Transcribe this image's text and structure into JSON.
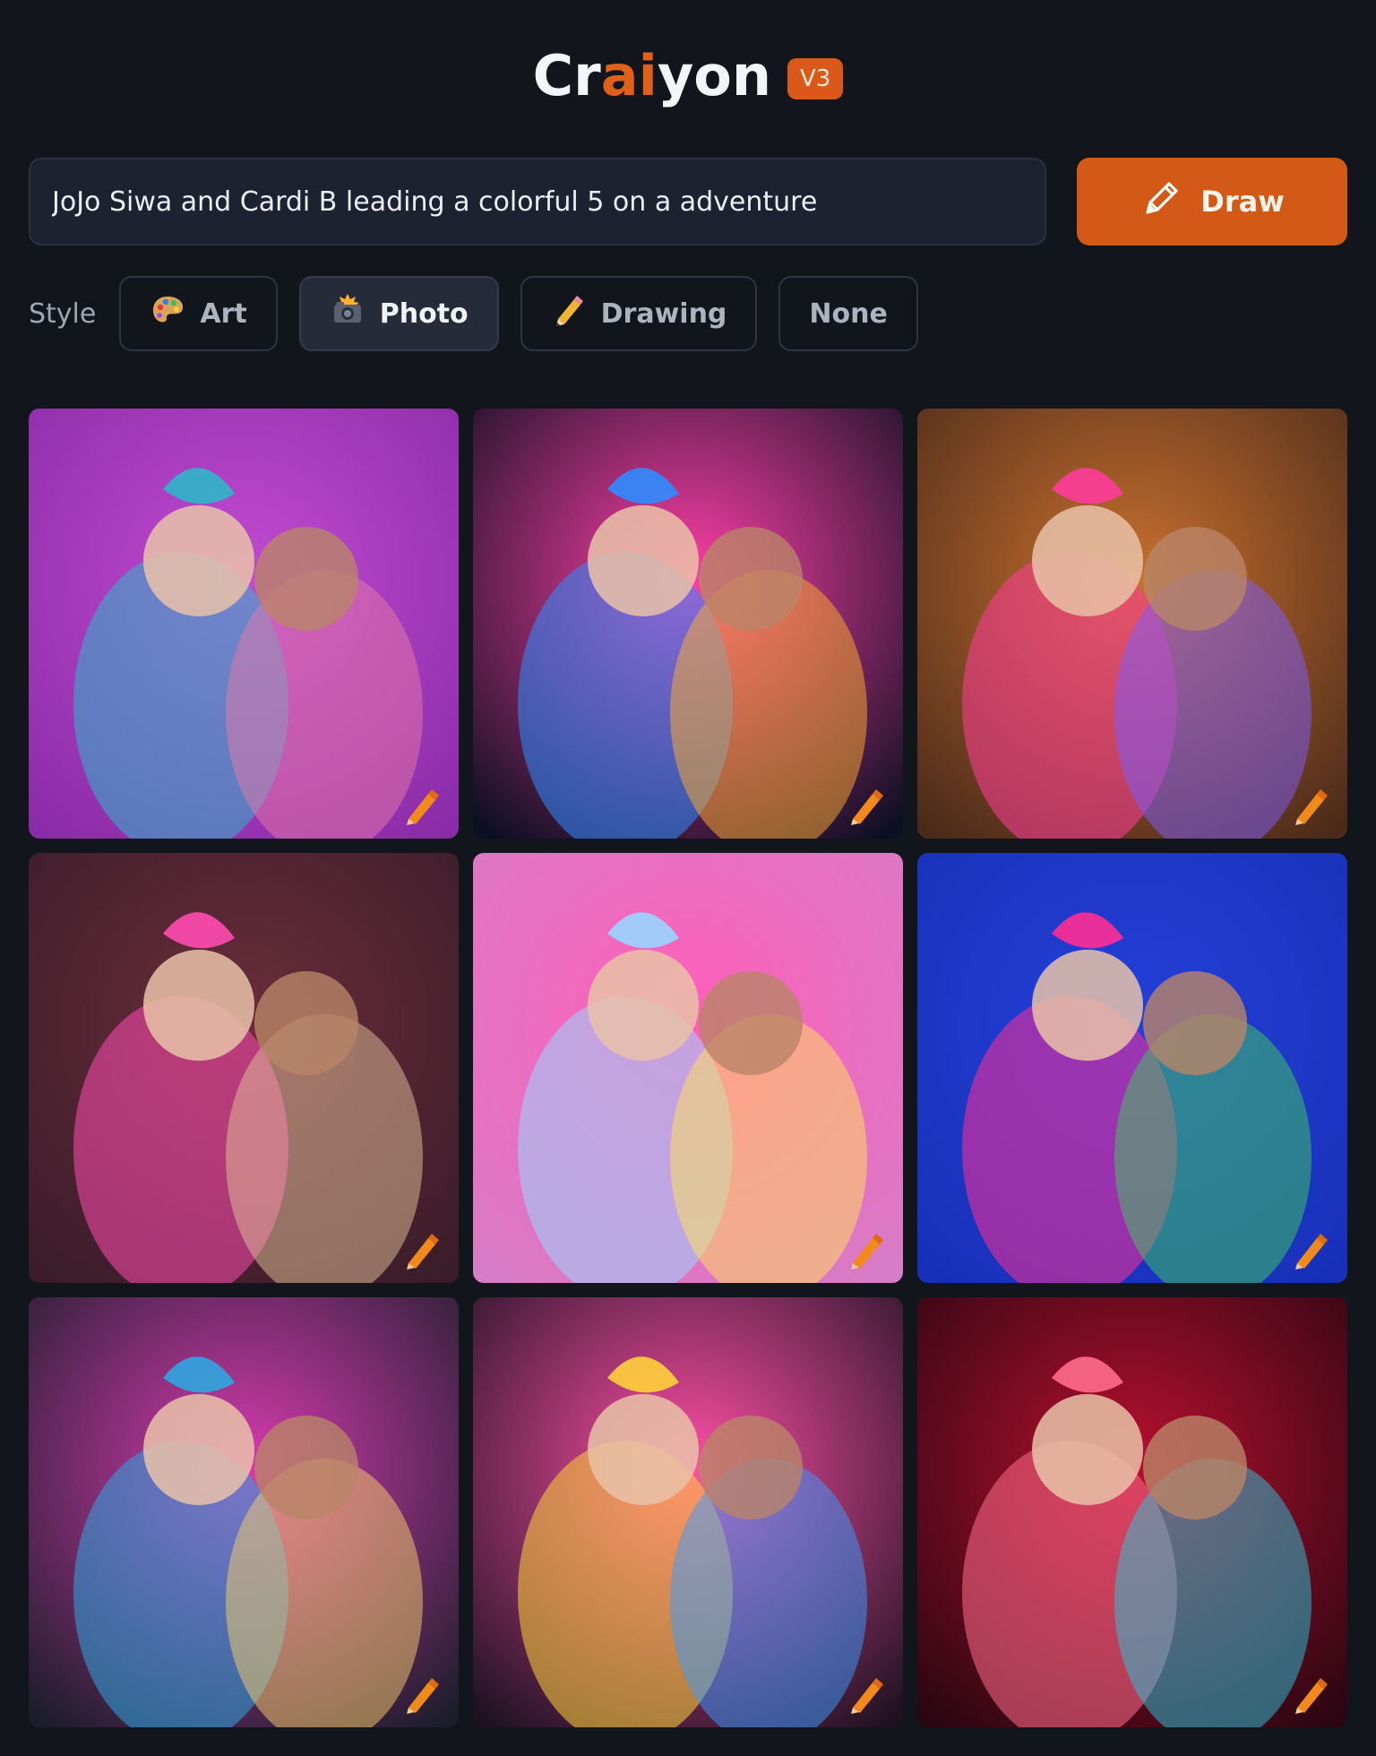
{
  "header": {
    "logo_part1": "Cr",
    "logo_accent": "ai",
    "logo_part2": "yon",
    "version": "V3"
  },
  "prompt": {
    "value": "JoJo Siwa and Cardi B leading a colorful 5 on a adventure"
  },
  "draw_button": {
    "label": "Draw",
    "icon": "pencil-icon"
  },
  "style": {
    "label": "Style",
    "options": [
      {
        "label": "Art",
        "icon": "palette-icon",
        "selected": false
      },
      {
        "label": "Photo",
        "icon": "camera-flash-icon",
        "selected": true
      },
      {
        "label": "Drawing",
        "icon": "pencil-icon",
        "selected": false
      },
      {
        "label": "None",
        "icon": "",
        "selected": false
      }
    ]
  },
  "colors": {
    "background": "#13151d",
    "accent": "#d35a16",
    "input_bg": "#1e2230"
  },
  "results": {
    "count": 9,
    "items": [
      {
        "description": "generated-image",
        "palette": [
          "#8a2ba8",
          "#c24bd1",
          "#2fb6c9",
          "#e67aa8"
        ]
      },
      {
        "description": "generated-image",
        "palette": [
          "#0c0f22",
          "#ff3fa6",
          "#2f8cff",
          "#ffb02e"
        ]
      },
      {
        "description": "generated-image",
        "palette": [
          "#4a2a1a",
          "#c9702e",
          "#ff3d9a",
          "#7c5cff"
        ]
      },
      {
        "description": "generated-image",
        "palette": [
          "#3a1c2a",
          "#6b2d3a",
          "#ff4bb0",
          "#e2c39a"
        ]
      },
      {
        "description": "generated-image",
        "palette": [
          "#d77cc6",
          "#ff5fb9",
          "#9ad6ff",
          "#ffe35a"
        ]
      },
      {
        "description": "generated-image",
        "palette": [
          "#1830b8",
          "#2440d8",
          "#ff2d95",
          "#3ecb5c"
        ]
      },
      {
        "description": "generated-image",
        "palette": [
          "#1c1d2b",
          "#d83bb0",
          "#2fa6e0",
          "#f7d06b"
        ]
      },
      {
        "description": "generated-image",
        "palette": [
          "#1e1222",
          "#ff4fa6",
          "#ffd23a",
          "#3a9cff"
        ]
      },
      {
        "description": "generated-image",
        "palette": [
          "#2a0612",
          "#b8102e",
          "#ff6b8a",
          "#2ac6d9"
        ]
      }
    ]
  }
}
